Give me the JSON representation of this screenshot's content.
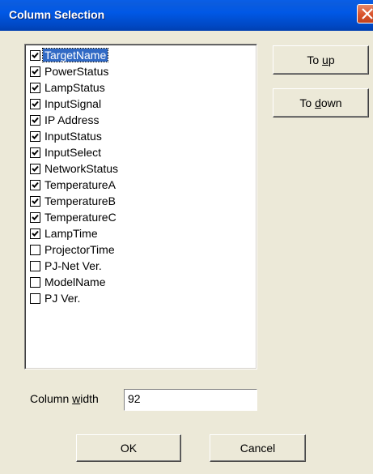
{
  "window": {
    "title": "Column Selection",
    "close_icon": "close-icon"
  },
  "columns": [
    {
      "label": "TargetName",
      "checked": true,
      "selected": true
    },
    {
      "label": "PowerStatus",
      "checked": true
    },
    {
      "label": "LampStatus",
      "checked": true
    },
    {
      "label": "InputSignal",
      "checked": true
    },
    {
      "label": "IP Address",
      "checked": true
    },
    {
      "label": "InputStatus",
      "checked": true
    },
    {
      "label": "InputSelect",
      "checked": true
    },
    {
      "label": "NetworkStatus",
      "checked": true
    },
    {
      "label": "TemperatureA",
      "checked": true
    },
    {
      "label": "TemperatureB",
      "checked": true
    },
    {
      "label": "TemperatureC",
      "checked": true
    },
    {
      "label": "LampTime",
      "checked": true
    },
    {
      "label": "ProjectorTime",
      "checked": false
    },
    {
      "label": "PJ-Net Ver.",
      "checked": false
    },
    {
      "label": "ModelName",
      "checked": false
    },
    {
      "label": "PJ Ver.",
      "checked": false
    }
  ],
  "buttons": {
    "to_up_prefix": "To ",
    "to_up_mnemonic": "u",
    "to_up_suffix": "p",
    "to_down_prefix": "To ",
    "to_down_mnemonic": "d",
    "to_down_suffix": "own",
    "ok": "OK",
    "cancel": "Cancel"
  },
  "column_width": {
    "label_prefix": "Column ",
    "label_mnemonic": "w",
    "label_suffix": "idth",
    "value": "92"
  },
  "colors": {
    "titlebar": "#0058E6",
    "dialog_bg": "#ECE9D8",
    "selection": "#316AC5",
    "close_button": "#D9532C"
  }
}
